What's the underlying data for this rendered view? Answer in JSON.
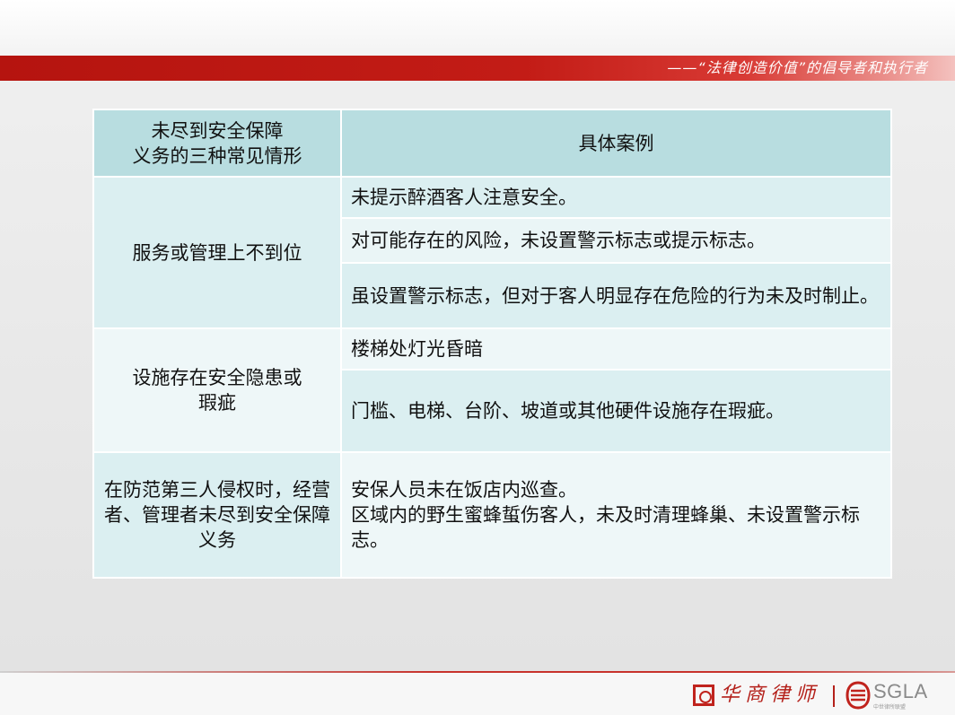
{
  "header": {
    "slogan": "——“法律创造价值”的倡导者和执行者"
  },
  "table": {
    "header_col1": "未尽到安全保障\n义务的三种常见情形",
    "header_col2": "具体案例",
    "groups": [
      {
        "category": "服务或管理上不到位",
        "items": [
          "未提示醉酒客人注意安全。",
          "对可能存在的风险，未设置警示标志或提示标志。",
          "虽设置警示标志，但对于客人明显存在危险的行为未及时制止。"
        ]
      },
      {
        "category": "设施存在安全隐患或\n瑕疵",
        "items": [
          "楼梯处灯光昏暗",
          "门槛、电梯、台阶、坡道或其他硬件设施存在瑕疵。"
        ]
      },
      {
        "category": "在防范第三人侵权时，经营者、管理者未尽到安全保障义务",
        "items": [
          "安保人员未在饭店内巡查。\n区域内的野生蜜蜂蜇伤客人，未及时清理蜂巢、未设置警示标志。"
        ]
      }
    ]
  },
  "footer": {
    "firm_name": "华商律师",
    "brand": "SGLA",
    "brand_sub": "中世律所联盟"
  },
  "colors": {
    "brand_red": "#c31c16",
    "header_cell": "#b8dde0",
    "body_cell": "#dbeff1",
    "body_cell_alt": "#eef7f8"
  }
}
